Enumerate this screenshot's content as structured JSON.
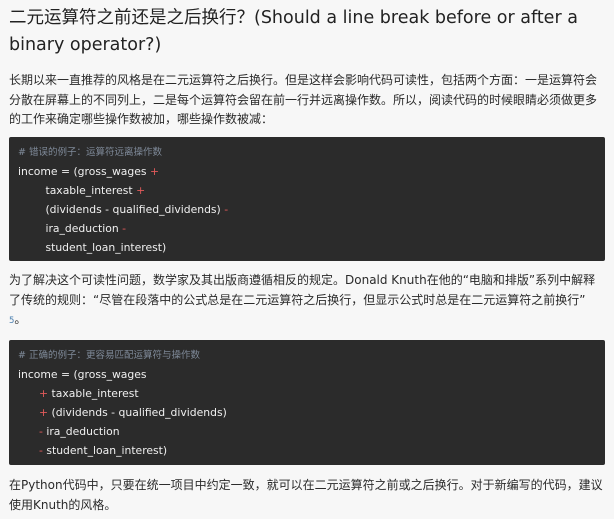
{
  "heading": "二元运算符之前还是之后换行？(Should a line break before or after a binary operator?)",
  "paragraph1": "长期以来一直推荐的风格是在二元运算符之后换行。但是这样会影响代码可读性，包括两个方面：一是运算符会分散在屏幕上的不同列上，二是每个运算符会留在前一行并远离操作数。所以，阅读代码的时候眼睛必须做更多的工作来确定哪些操作数被加，哪些操作数被减：",
  "code_wrong": {
    "comment": "# 错误的例子：运算符远离操作数",
    "lines": [
      {
        "text": "income = (gross_wages ",
        "op": "+"
      },
      {
        "text": "        taxable_interest ",
        "op": "+"
      },
      {
        "text": "        (dividends - qualified_dividends) ",
        "op": "-"
      },
      {
        "text": "        ira_deduction ",
        "op": "-"
      },
      {
        "text": "        student_loan_interest)",
        "op": ""
      }
    ]
  },
  "paragraph2_text": "为了解决这个可读性问题，数学家及其出版商遵循相反的规定。Donald Knuth在他的“电脑和排版”系列中解释了传统的规则：“尽管在段落中的公式总是在二元运算符之后换行，但显示公式时总是在二元运算符之前换行”",
  "paragraph2_cite": "5",
  "paragraph2_tail": "。",
  "code_right": {
    "comment": "# 正确的例子：更容易匹配运算符与操作数",
    "lines": [
      {
        "op": "",
        "text": "income = (gross_wages"
      },
      {
        "op": "+",
        "text": " taxable_interest"
      },
      {
        "op": "+",
        "text": " (dividends - qualified_dividends)"
      },
      {
        "op": "-",
        "text": " ira_deduction"
      },
      {
        "op": "-",
        "text": " student_loan_interest)"
      }
    ]
  },
  "paragraph3": "在Python代码中，只要在统一项目中约定一致，就可以在二元运算符之前或之后换行。对于新编写的代码，建议使用Knuth的风格。"
}
